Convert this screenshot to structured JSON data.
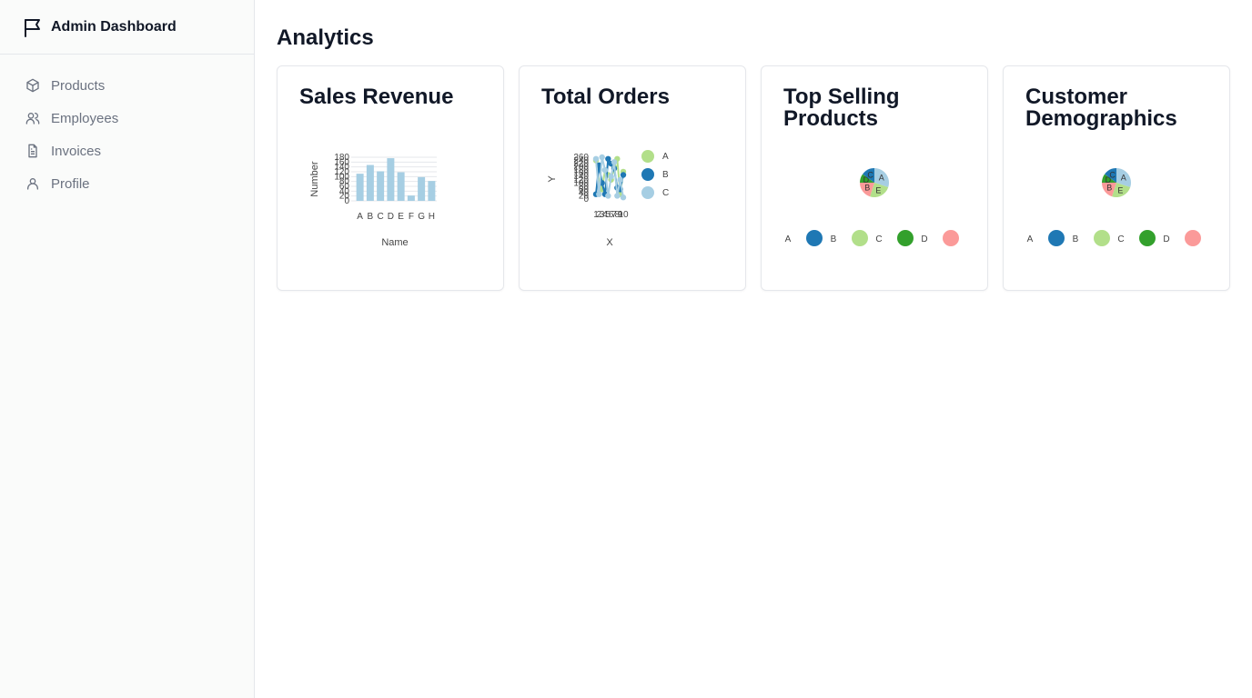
{
  "sidebar": {
    "brand": "Admin Dashboard",
    "items": [
      {
        "label": "Products",
        "icon": "box-icon"
      },
      {
        "label": "Employees",
        "icon": "users-icon"
      },
      {
        "label": "Invoices",
        "icon": "file-text-icon"
      },
      {
        "label": "Profile",
        "icon": "user-icon"
      }
    ]
  },
  "main": {
    "title": "Analytics"
  },
  "colors": {
    "light_blue": "#a6cee3",
    "dark_blue": "#1f78b4",
    "light_green": "#b2df8a",
    "dark_green": "#33a02c",
    "pink": "#fb9a99"
  },
  "cards": [
    {
      "title": "Sales Revenue"
    },
    {
      "title": "Total Orders"
    },
    {
      "title": "Top Selling Products"
    },
    {
      "title": "Customer Demographics"
    }
  ],
  "chart_data": [
    {
      "type": "bar",
      "categories": [
        "A",
        "B",
        "C",
        "D",
        "E",
        "F",
        "G",
        "H"
      ],
      "values": [
        112,
        148,
        122,
        176,
        118,
        22,
        98,
        82
      ],
      "xlabel": "Name",
      "ylabel": "Number",
      "yticks": [
        0,
        20,
        40,
        60,
        80,
        100,
        120,
        140,
        160,
        180
      ],
      "ylim": [
        0,
        180
      ]
    },
    {
      "type": "scatter",
      "xlabel": "X",
      "ylabel": "Y",
      "xticks": [
        1,
        2,
        3,
        4,
        5,
        6,
        7,
        8,
        9,
        10
      ],
      "yticks": [
        0,
        20,
        40,
        60,
        80,
        100,
        120,
        140,
        160,
        180,
        200,
        220,
        240,
        260
      ],
      "xlim": [
        1,
        10
      ],
      "ylim": [
        0,
        260
      ],
      "series": [
        {
          "name": "A",
          "x": [
            1,
            3,
            5,
            7,
            9,
            2,
            4,
            6,
            8,
            10
          ],
          "y": [
            240,
            60,
            150,
            200,
            30,
            90,
            180,
            120,
            250,
            170
          ]
        },
        {
          "name": "B",
          "x": [
            1,
            2,
            4,
            5,
            7,
            8,
            10,
            3,
            6,
            9
          ],
          "y": [
            30,
            210,
            30,
            250,
            190,
            70,
            150,
            100,
            220,
            60
          ]
        },
        {
          "name": "C",
          "x": [
            1,
            2,
            3,
            4,
            5,
            6,
            7,
            8,
            9,
            10
          ],
          "y": [
            250,
            30,
            260,
            180,
            20,
            140,
            230,
            20,
            120,
            10
          ]
        }
      ]
    },
    {
      "type": "pie",
      "labels": [
        "A",
        "B",
        "C",
        "D",
        "E"
      ],
      "values": [
        30,
        20,
        15,
        10,
        25
      ],
      "legend": [
        "A",
        "B",
        "C",
        "D"
      ]
    },
    {
      "type": "pie",
      "labels": [
        "A",
        "B",
        "C",
        "D",
        "E"
      ],
      "values": [
        30,
        20,
        15,
        10,
        25
      ],
      "legend": [
        "A",
        "B",
        "C",
        "D"
      ]
    }
  ]
}
